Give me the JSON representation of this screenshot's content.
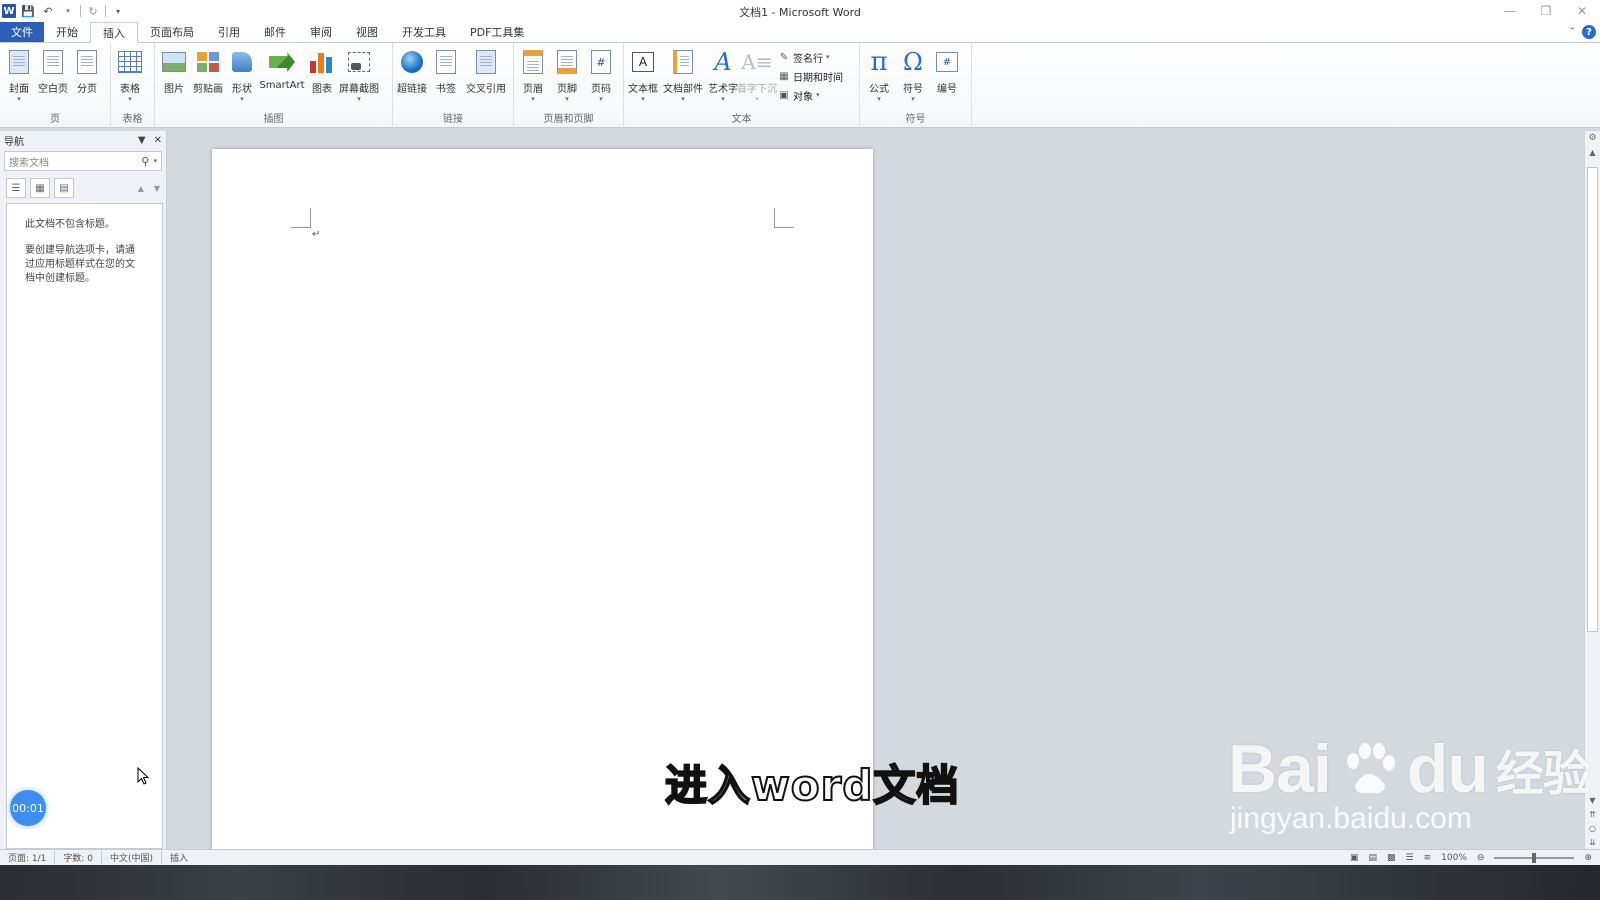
{
  "titlebar": {
    "title": "文档1 - Microsoft Word",
    "qat_icons": [
      "word-logo-icon",
      "save-icon",
      "undo-icon",
      "redo-icon",
      "customize-icon"
    ],
    "window_controls": [
      "minimize-icon",
      "restore-icon",
      "close-icon"
    ]
  },
  "tabs": [
    {
      "label": "文件",
      "active": false
    },
    {
      "label": "开始",
      "active": false
    },
    {
      "label": "插入",
      "active": true
    },
    {
      "label": "页面布局",
      "active": false
    },
    {
      "label": "引用",
      "active": false
    },
    {
      "label": "邮件",
      "active": false
    },
    {
      "label": "审阅",
      "active": false
    },
    {
      "label": "视图",
      "active": false
    },
    {
      "label": "开发工具",
      "active": false
    },
    {
      "label": "PDF工具集",
      "active": false
    }
  ],
  "ribbon": {
    "groups": {
      "pages": {
        "label": "页",
        "buttons": [
          "封面",
          "空白页",
          "分页"
        ]
      },
      "tables": {
        "label": "表格",
        "buttons": [
          "表格"
        ]
      },
      "illustrations": {
        "label": "插图",
        "buttons": [
          "图片",
          "剪贴画",
          "形状",
          "SmartArt",
          "图表",
          "屏幕截图"
        ]
      },
      "links": {
        "label": "链接",
        "buttons": [
          "超链接",
          "书签",
          "交叉引用"
        ]
      },
      "header_footer": {
        "label": "页眉和页脚",
        "buttons": [
          "页眉",
          "页脚",
          "页码"
        ]
      },
      "text": {
        "label": "文本",
        "buttons": [
          "文本框",
          "文档部件",
          "艺术字",
          "首字下沉"
        ],
        "small": [
          "签名行",
          "日期和时间",
          "对象"
        ]
      },
      "symbols": {
        "label": "符号",
        "buttons": [
          "公式",
          "符号",
          "编号"
        ]
      }
    }
  },
  "navpane": {
    "title": "导航",
    "search_placeholder": "搜索文档",
    "msg1": "此文档不包含标题。",
    "msg2": "要创建导航选项卡，请通过应用标题样式在您的文档中创建标题。"
  },
  "statusbar": {
    "page": "页面: 1/1",
    "words": "字数: 0",
    "lang": "中文(中国)",
    "mode": "插入",
    "zoom": "100%"
  },
  "overlay": {
    "timer": "00:01",
    "subtitle": "进入word文档",
    "watermark_logo_latin": "Bai",
    "watermark_logo_latin2": "du",
    "watermark_logo_cn": "经验",
    "watermark_url": "jingyan.baidu.com"
  },
  "colors": {
    "file_tab": "#2b5fb4",
    "accent": "#2b579a",
    "timer": "#3d8ef0"
  }
}
